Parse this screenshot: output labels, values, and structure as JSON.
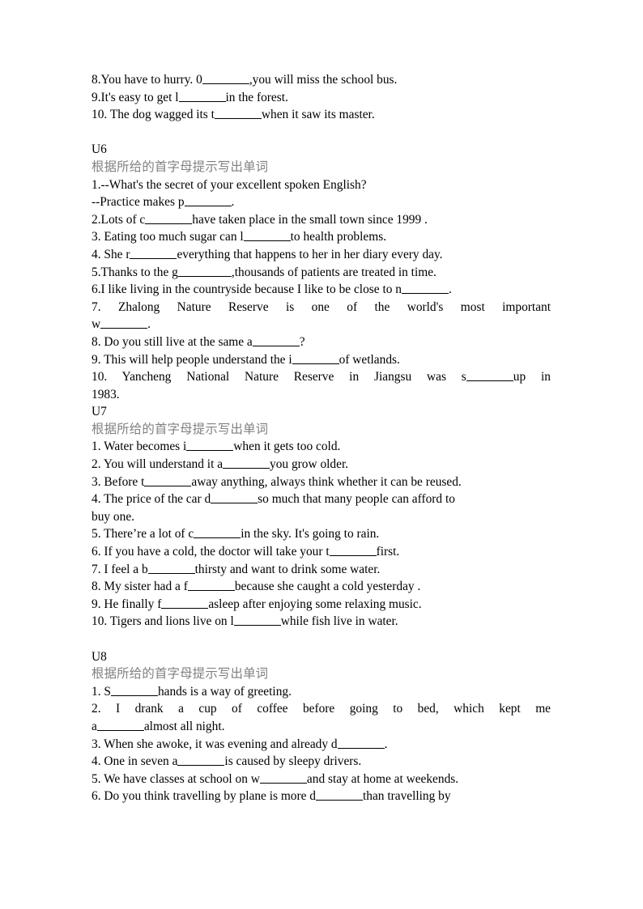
{
  "document": {
    "page_background": "#ffffff",
    "text_color": "#000000",
    "heading_color": "#808080"
  },
  "intro_block": {
    "items": [
      {
        "number": "8.",
        "pre": "You have to hurry. 0",
        "post": ",you will miss the school bus.",
        "blank": "md"
      },
      {
        "number": "9.",
        "pre": "It's easy to get l",
        "post": "in the forest.",
        "blank": "md"
      },
      {
        "number": "10.",
        "pre": " The dog wagged its t",
        "post": "when it saw its master.",
        "blank": "md"
      }
    ]
  },
  "sections": [
    {
      "unit": "U6",
      "instruction": "根据所给的首字母提示写出单词",
      "items": [
        {
          "id": "u6-1",
          "lines": [
            {
              "text_pre": "1.--What's the secret of your excellent spoken English?",
              "blank": null,
              "text_post": ""
            },
            {
              "text_pre": "--Practice makes p",
              "blank": "md",
              "text_post": "."
            }
          ]
        },
        {
          "id": "u6-2",
          "lines": [
            {
              "text_pre": "2.Lots of c",
              "blank": "md",
              "text_post": "have taken place in the small town since 1999 ."
            }
          ]
        },
        {
          "id": "u6-3",
          "lines": [
            {
              "text_pre": "3. Eating too much sugar can l",
              "blank": "md",
              "text_post": "to health problems."
            }
          ]
        },
        {
          "id": "u6-4",
          "lines": [
            {
              "text_pre": "4. She r",
              "blank": "md",
              "text_post": "everything that happens to her in her diary every day."
            }
          ]
        },
        {
          "id": "u6-5",
          "lines": [
            {
              "text_pre": "5.Thanks to the g",
              "blank": "lg",
              "text_post": ",thousands of patients are treated in time."
            }
          ]
        },
        {
          "id": "u6-6",
          "lines": [
            {
              "text_pre": "6.I like living in the countryside because I like to be close to n",
              "blank": "md",
              "text_post": "."
            }
          ]
        },
        {
          "id": "u6-7",
          "lines": [
            {
              "text_pre": "7.  Zhalong  Nature  Reserve  is  one  of  the  world's  most  important",
              "blank": null,
              "text_post": "",
              "justify": true
            },
            {
              "text_pre": "w",
              "blank": "md",
              "text_post": "."
            }
          ]
        },
        {
          "id": "u6-8",
          "lines": [
            {
              "text_pre": "8. Do you still live at the same a",
              "blank": "md",
              "text_post": "?"
            }
          ]
        },
        {
          "id": "u6-9",
          "lines": [
            {
              "text_pre": "9. This will help people understand the i",
              "blank": "md",
              "text_post": "of wetlands."
            }
          ]
        },
        {
          "id": "u6-10",
          "lines": [
            {
              "text_pre": "10.  Yancheng  National  Nature  Reserve  in  Jiangsu  was  s",
              "blank": "md",
              "text_post": "up in",
              "justify": true
            },
            {
              "text_pre": "1983.",
              "blank": null,
              "text_post": ""
            }
          ]
        }
      ]
    },
    {
      "unit": "U7",
      "instruction": "根据所给的首字母提示写出单词",
      "items": [
        {
          "id": "u7-1",
          "lines": [
            {
              "text_pre": "1. Water becomes i",
              "blank": "md",
              "text_post": "when it gets too cold."
            }
          ]
        },
        {
          "id": "u7-2",
          "lines": [
            {
              "text_pre": "2. You will understand it a",
              "blank": "md",
              "text_post": "you grow older."
            }
          ]
        },
        {
          "id": "u7-3",
          "lines": [
            {
              "text_pre": "3. Before t",
              "blank": "md",
              "text_post": "away anything, always think whether it can be reused."
            }
          ]
        },
        {
          "id": "u7-4",
          "lines": [
            {
              "text_pre": "4. The price of the car d",
              "blank": "md",
              "text_post": "so much that many people can afford to"
            },
            {
              "text_pre": "buy one.",
              "blank": null,
              "text_post": ""
            }
          ]
        },
        {
          "id": "u7-5",
          "lines": [
            {
              "text_pre": "5. There’re a lot of c",
              "blank": "md",
              "text_post": "in the sky. It's going to rain."
            }
          ]
        },
        {
          "id": "u7-6",
          "lines": [
            {
              "text_pre": "6. If you have a cold, the doctor will take your t",
              "blank": "md",
              "text_post": "first."
            }
          ]
        },
        {
          "id": "u7-7",
          "lines": [
            {
              "text_pre": "7. I feel a b",
              "blank": "md",
              "text_post": "thirsty and want to drink some water."
            }
          ]
        },
        {
          "id": "u7-8",
          "lines": [
            {
              "text_pre": "8. My sister had a f",
              "blank": "md",
              "text_post": "because she caught a cold yesterday ."
            }
          ]
        },
        {
          "id": "u7-9",
          "lines": [
            {
              "text_pre": "9. He finally f",
              "blank": "md",
              "text_post": "asleep after enjoying some relaxing music."
            }
          ]
        },
        {
          "id": "u7-10",
          "lines": [
            {
              "text_pre": "10. Tigers and lions live on l",
              "blank": "md",
              "text_post": "while fish live in water."
            }
          ]
        }
      ]
    },
    {
      "unit": "U8",
      "instruction": "根据所给的首字母提示写出单词",
      "items": [
        {
          "id": "u8-1",
          "lines": [
            {
              "text_pre": "1. S",
              "blank": "md",
              "text_post": "hands is a way of greeting."
            }
          ]
        },
        {
          "id": "u8-2",
          "lines": [
            {
              "text_pre": "2.  I  drank  a  cup  of  coffee  before  going  to  bed,  which  kept  me",
              "blank": null,
              "text_post": "",
              "justify": true
            },
            {
              "text_pre": "a",
              "blank": "md",
              "text_post": "almost all night."
            }
          ]
        },
        {
          "id": "u8-3",
          "lines": [
            {
              "text_pre": "3. When she awoke, it was evening and already d",
              "blank": "md",
              "text_post": "."
            }
          ]
        },
        {
          "id": "u8-4",
          "lines": [
            {
              "text_pre": "4. One in seven a",
              "blank": "md",
              "text_post": "is caused by sleepy drivers."
            }
          ]
        },
        {
          "id": "u8-5",
          "lines": [
            {
              "text_pre": "5. We have classes at school on w",
              "blank": "md",
              "text_post": "and stay at home at weekends."
            }
          ]
        },
        {
          "id": "u8-6",
          "lines": [
            {
              "text_pre": "6. Do you think travelling by plane is more d",
              "blank": "md",
              "text_post": "than travelling by"
            }
          ]
        }
      ]
    }
  ]
}
